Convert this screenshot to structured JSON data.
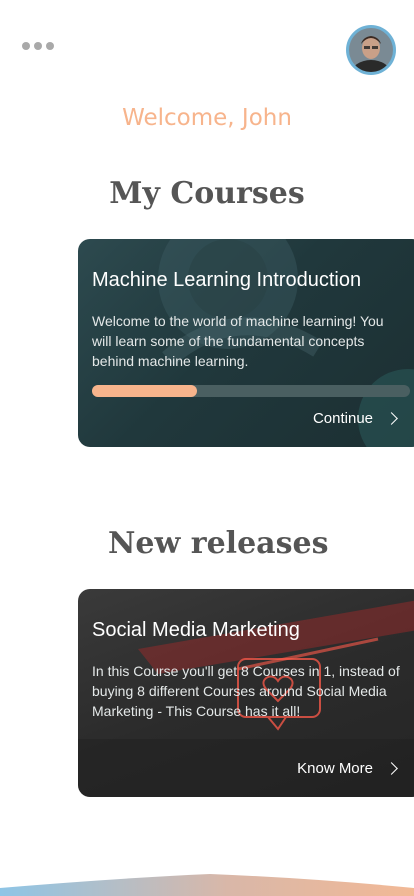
{
  "header": {
    "menu_icon": "more-dots-icon",
    "avatar_icon": "user-avatar"
  },
  "welcome_text": "Welcome, John",
  "my_courses": {
    "title": "My Courses",
    "course": {
      "title": "Machine Learning Introduction",
      "description": "Welcome to the world of machine learning! You will learn some of the fundamental concepts behind machine learning.",
      "progress": 0.33,
      "action_label": "Continue"
    }
  },
  "new_releases": {
    "title": "New releases",
    "course": {
      "title": "Social Media Marketing",
      "description": "In this Course you'll get 8 Courses in 1, instead of buying 8 different Courses around Social Media Marketing - This Course has it all!",
      "action_label": "Know More"
    }
  },
  "colors": {
    "accent": "#f7b48c",
    "heading": "#555555",
    "avatar_ring": "#6fb2d6"
  }
}
